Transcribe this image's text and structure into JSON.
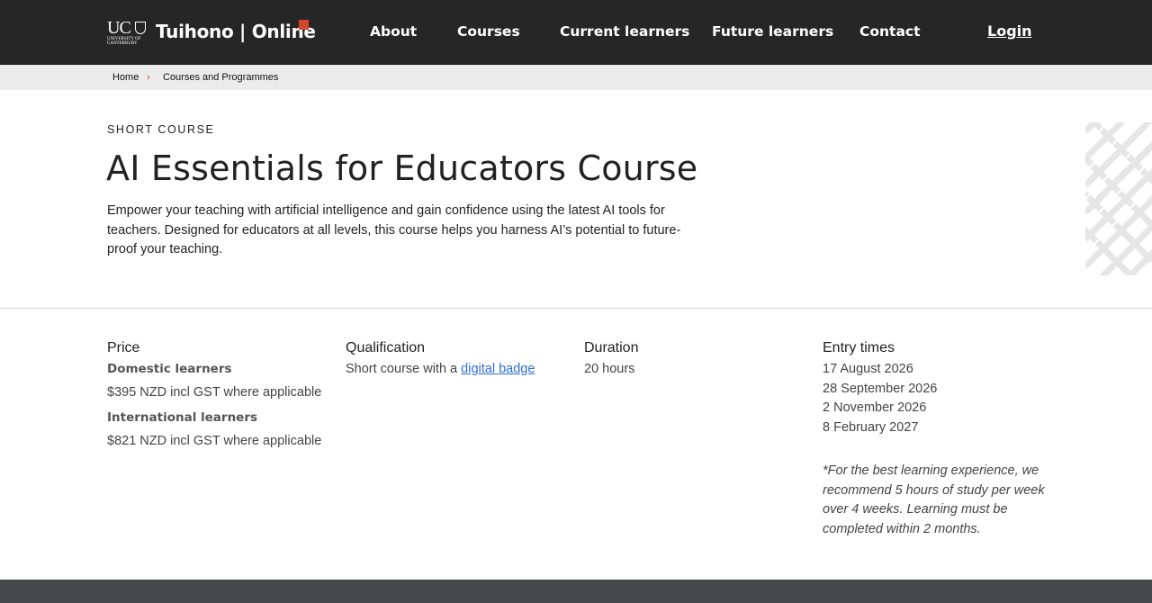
{
  "header": {
    "logo_letters": "UC",
    "logo_small": "UNIVERSITY OF\nCANTERBURY",
    "brand": "Tuihono | Online",
    "nav": [
      "About",
      "Courses",
      "Current learners",
      "Future learners",
      "Contact"
    ],
    "login": "Login"
  },
  "breadcrumb": {
    "home": "Home",
    "separator": "›",
    "current": "Courses and Programmes"
  },
  "hero": {
    "eyebrow": "SHORT COURSE",
    "title": "AI Essentials for Educators Course",
    "intro": "Empower your teaching with artificial intelligence and gain confidence using the latest AI tools for teachers. Designed for educators at all levels, this course helps you harness AI’s potential to future-proof your teaching."
  },
  "info": {
    "price": {
      "heading": "Price",
      "domestic_label": "Domestic learners",
      "domestic_value": "$395 NZD incl GST where applicable",
      "international_label": "International learners",
      "international_value": "$821 NZD incl GST where applicable"
    },
    "qualification": {
      "heading": "Qualification",
      "text": "Short course with a ",
      "link": "digital badge"
    },
    "duration": {
      "heading": "Duration",
      "value": "20 hours"
    },
    "entry": {
      "heading": "Entry times",
      "dates": [
        "17 August 2026",
        "28 September 2026",
        "2 November 2026",
        "8 February 2027"
      ],
      "note": "*For the best learning experience, we recommend 5 hours of study per week over 4 weeks. Learning must be completed within 2 months."
    }
  },
  "colors": {
    "header_bg": "#262626",
    "accent": "#d2462a",
    "breadcrumb_bg": "#ebebeb",
    "link": "#2f6fd6",
    "footer_bg": "#46484c"
  }
}
